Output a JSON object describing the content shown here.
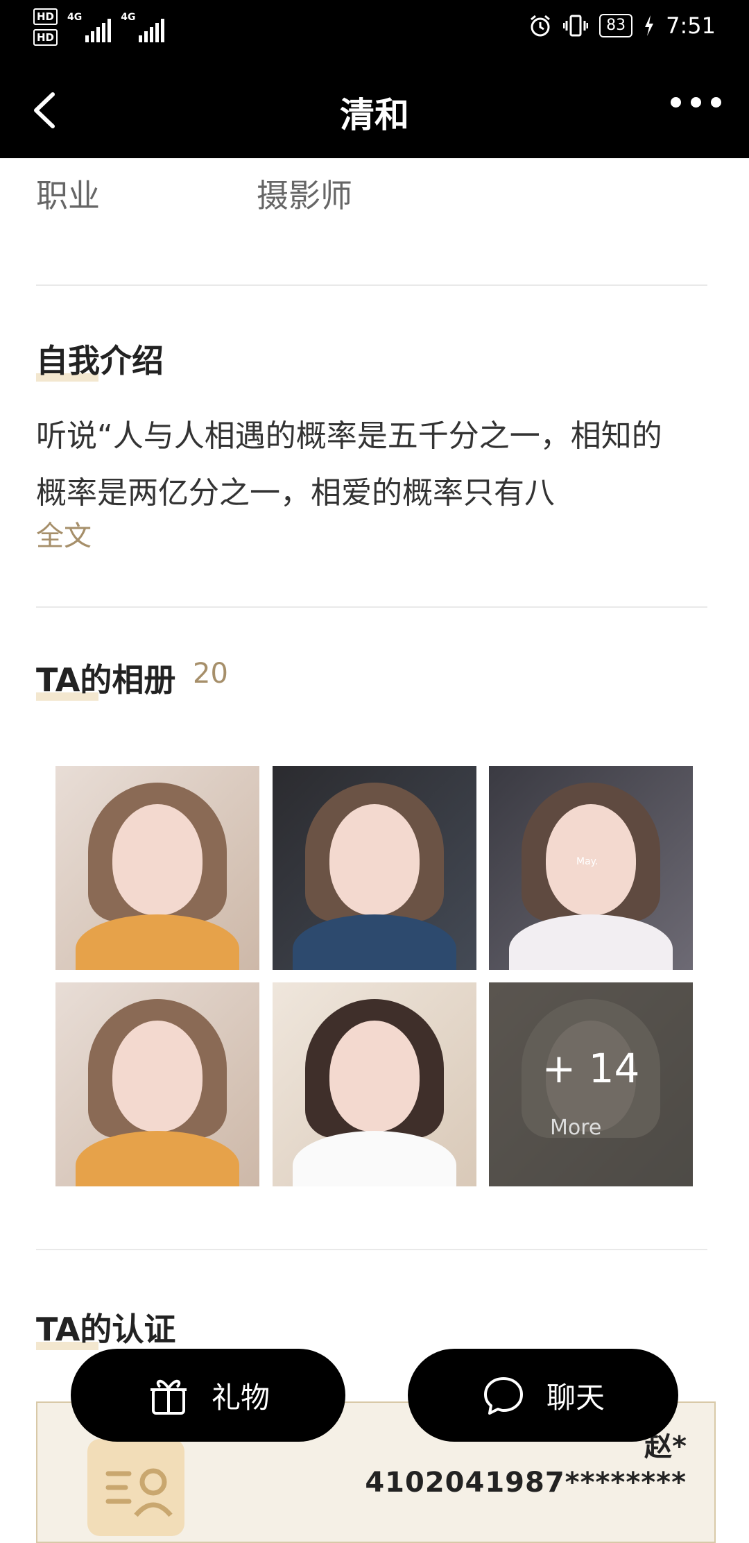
{
  "status_bar": {
    "sim1": "HD",
    "sim2": "HD",
    "net1": "4G",
    "net2": "4G",
    "battery": "83",
    "time": "7:51"
  },
  "header": {
    "title": "清和"
  },
  "profile": {
    "job_label": "职业",
    "job_value": "摄影师"
  },
  "intro": {
    "title": "自我介绍",
    "text": "听说“人与人相遇的概率是五千分之一，相知的概率是两亿分之一，相爱的概率只有八",
    "expand_label": "全文"
  },
  "album": {
    "title": "TA的相册",
    "count": "20",
    "more_count": "+ 14",
    "more_label": "More",
    "photo_caption": "May."
  },
  "verification": {
    "title": "TA的认证",
    "name": "赵*",
    "id_number": "4102041987********"
  },
  "actions": {
    "gift_label": "礼物",
    "chat_label": "聊天"
  }
}
